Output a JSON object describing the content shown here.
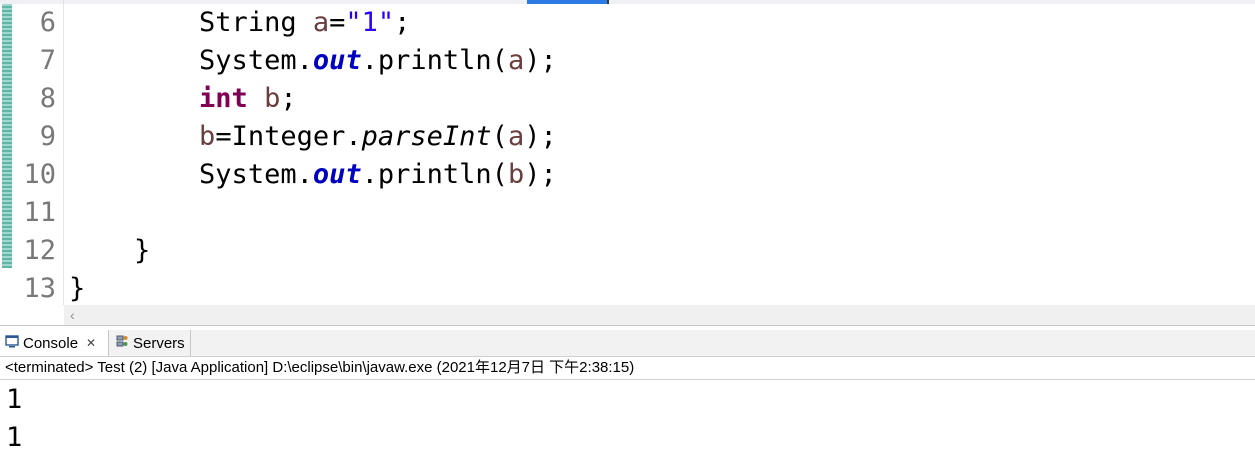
{
  "editor": {
    "line_numbers": [
      "6",
      "7",
      "8",
      "9",
      "10",
      "11",
      "12",
      "13"
    ],
    "lines": [
      {
        "indent": "        ",
        "t1": "String ",
        "v1": "a",
        "t2": "=",
        "s1": "\"1\"",
        "t3": ";"
      },
      {
        "indent": "        ",
        "t1": "System.",
        "f1": "out",
        "t2": ".println(",
        "v1": "a",
        "t3": ");"
      },
      {
        "indent": "        ",
        "k1": "int",
        "t1": " ",
        "v1": "b",
        "t2": ";"
      },
      {
        "indent": "        ",
        "v1": "b",
        "t1": "=Integer.",
        "m1": "parseInt",
        "t2": "(",
        "v2": "a",
        "t3": ");"
      },
      {
        "indent": "        ",
        "t1": "System.",
        "f1": "out",
        "t2": ".println(",
        "v1": "b",
        "t3": ");"
      },
      {
        "text": ""
      },
      {
        "text": "    }"
      },
      {
        "text": "}"
      }
    ],
    "scroll_left_glyph": "‹"
  },
  "console": {
    "tabs": [
      {
        "label": "Console",
        "icon": "console-icon",
        "close": "✕"
      },
      {
        "label": "Servers",
        "icon": "servers-icon"
      }
    ],
    "status": "<terminated> Test (2) [Java Application] D:\\eclipse\\bin\\javaw.exe (2021年12月7日 下午2:38:15)",
    "output": [
      "1",
      "1"
    ]
  },
  "colors": {
    "keyword": "#7f0055",
    "string": "#2a00ff",
    "field": "#0000c0",
    "local_var": "#6a3e3e",
    "line_number": "#787878"
  }
}
